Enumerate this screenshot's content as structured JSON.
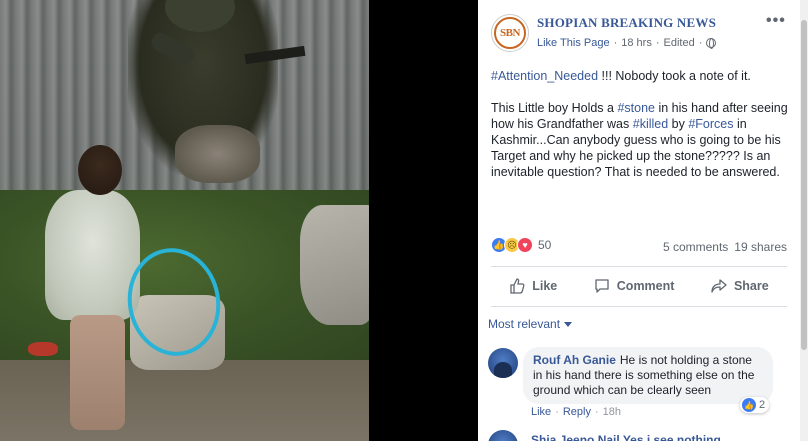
{
  "post": {
    "page_name": "SHOPIAN BREAKING NEWS",
    "logo_text": "SBN",
    "like_page": "Like This Page",
    "separator": "·",
    "time": "18 hrs",
    "edited": "Edited",
    "more_icon": "more-dots-icon",
    "text": {
      "p1_hashtag": "#Attention_Needed",
      "p1_rest": " !!! Nobody took a note of it.",
      "p2_a": "This Little boy Holds a ",
      "p2_stone": "#stone",
      "p2_b": " in his hand after seeing how his Grandfather was ",
      "p2_killed": "#killed",
      "p2_c": " by ",
      "p2_forces": "#Forces",
      "p2_d": " in Kashmir...Can anybody guess who is going to be his Target and why he picked up the stone????? Is an inevitable question? That is needed to be answered."
    },
    "reactions": {
      "count": "50",
      "icons": [
        "like-reaction-icon",
        "sad-reaction-icon",
        "love-reaction-icon"
      ],
      "comments": "5 comments",
      "shares": "19 shares"
    },
    "actions": {
      "like": "Like",
      "comment": "Comment",
      "share": "Share"
    },
    "sort_label": "Most relevant",
    "comment": {
      "author": "Rouf Ah Ganie",
      "text": "He is not holding a stone in his hand there is something else on the ground which can be clearly seen",
      "like": "Like",
      "reply": "Reply",
      "time": "18h",
      "sep": "·",
      "reaction_count": "2"
    },
    "next_comment_preview": "Shia Jeeno Nail  Yes i see nothing"
  },
  "colors": {
    "link": "#385898",
    "text": "#1d2129",
    "muted": "#606770",
    "highlight_circle": "#29b3d6"
  }
}
